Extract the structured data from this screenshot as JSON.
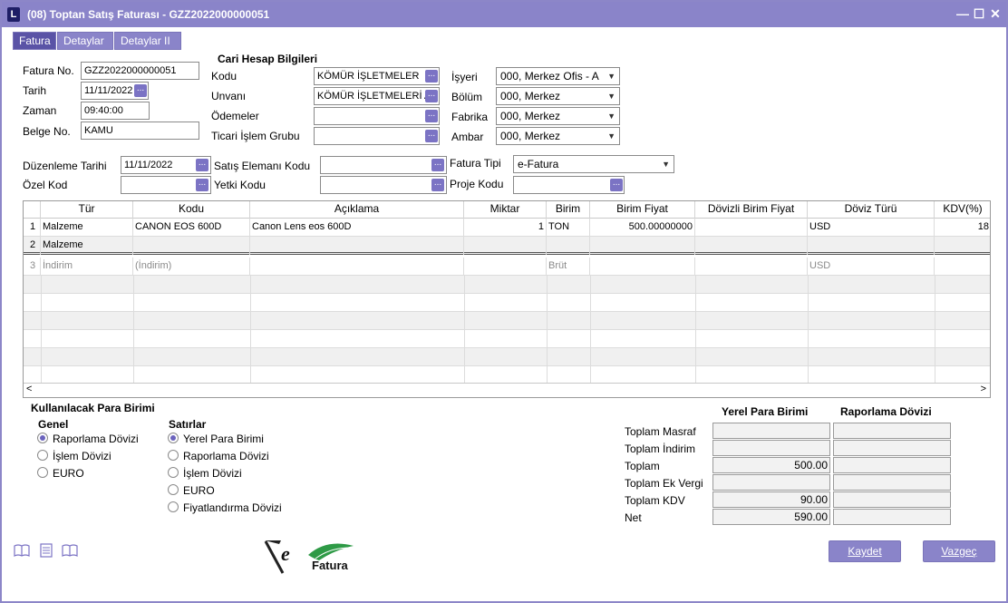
{
  "window": {
    "title": "(08) Toptan Satış Faturası - GZZ2022000000051",
    "app_letter": "L"
  },
  "tabs": [
    "Fatura",
    "Detaylar",
    "Detaylar II"
  ],
  "left": {
    "fatura_no_label": "Fatura No.",
    "fatura_no": "GZZ2022000000051",
    "tarih_label": "Tarih",
    "tarih": "11/11/2022",
    "zaman_label": "Zaman",
    "zaman": "09:40:00",
    "belge_no_label": "Belge No.",
    "belge_no": "KAMU"
  },
  "cari": {
    "heading": "Cari Hesap Bilgileri",
    "kodu_label": "Kodu",
    "kodu": "KÖMÜR İŞLETMELER",
    "unvani_label": "Unvanı",
    "unvani": "KÖMÜR İŞLETMELERİ AN",
    "odemeler_label": "Ödemeler",
    "odemeler": "",
    "ticari_label": "Ticari İşlem Grubu",
    "ticari": ""
  },
  "org": {
    "isyeri_label": "İşyeri",
    "isyeri": "000, Merkez Ofis - A",
    "bolum_label": "Bölüm",
    "bolum": "000, Merkez",
    "fabrika_label": "Fabrika",
    "fabrika": "000, Merkez",
    "ambar_label": "Ambar",
    "ambar": "000, Merkez"
  },
  "mid": {
    "duzenleme_label": "Düzenleme Tarihi",
    "duzenleme": "11/11/2022",
    "ozel_kod_label": "Özel Kod",
    "ozel_kod": "",
    "satis_label": "Satış Elemanı Kodu",
    "satis": "",
    "yetki_label": "Yetki Kodu",
    "yetki": "",
    "fatura_tipi_label": "Fatura Tipi",
    "fatura_tipi": "e-Fatura",
    "proje_label": "Proje Kodu",
    "proje": ""
  },
  "grid": {
    "columns": [
      "Tür",
      "Kodu",
      "Açıklama",
      "Miktar",
      "Birim",
      "Birim Fiyat",
      "Dövizli Birim Fiyat",
      "Döviz Türü",
      "KDV(%)"
    ],
    "rows": [
      {
        "n": "1",
        "tur": "Malzeme",
        "kodu": "CANON EOS 600D",
        "aciklama": "Canon Lens eos 600D",
        "miktar": "1",
        "birim": "TON",
        "fiyat": "500.00000000",
        "dfiyat": "",
        "doviz": "USD",
        "kdv": "18"
      },
      {
        "n": "2",
        "tur": "Malzeme",
        "kodu": "",
        "aciklama": "",
        "miktar": "",
        "birim": "",
        "fiyat": "",
        "dfiyat": "",
        "doviz": "",
        "kdv": ""
      },
      {
        "n": "3",
        "tur": "İndirim",
        "kodu": "(İndirim)",
        "aciklama": "",
        "miktar": "",
        "birim": "Brüt",
        "fiyat": "",
        "dfiyat": "",
        "doviz": "USD",
        "kdv": ""
      }
    ],
    "scroll_left": "<",
    "scroll_right": ">"
  },
  "currency": {
    "heading": "Kullanılacak Para Birimi",
    "genel_label": "Genel",
    "genel": [
      {
        "label": "Raporlama Dövizi",
        "on": true
      },
      {
        "label": "İşlem Dövizi",
        "on": false
      },
      {
        "label": "EURO",
        "on": false
      }
    ],
    "satirlar_label": "Satırlar",
    "satirlar": [
      {
        "label": "Yerel Para Birimi",
        "on": true
      },
      {
        "label": "Raporlama Dövizi",
        "on": false
      },
      {
        "label": "İşlem Dövizi",
        "on": false
      },
      {
        "label": "EURO",
        "on": false
      },
      {
        "label": "Fiyatlandırma Dövizi",
        "on": false
      }
    ]
  },
  "totals": {
    "col1": "Yerel Para Birimi",
    "col2": "Raporlama Dövizi",
    "rows": [
      {
        "label": "Toplam Masraf",
        "v1": "",
        "v2": ""
      },
      {
        "label": "Toplam İndirim",
        "v1": "",
        "v2": ""
      },
      {
        "label": "Toplam",
        "v1": "500.00",
        "v2": ""
      },
      {
        "label": "Toplam Ek Vergi",
        "v1": "",
        "v2": ""
      },
      {
        "label": "Toplam KDV",
        "v1": "90.00",
        "v2": ""
      },
      {
        "label": "Net",
        "v1": "590.00",
        "v2": ""
      }
    ]
  },
  "logo": {
    "letter": "e",
    "text": "Fatura"
  },
  "buttons": {
    "save": "Kaydet",
    "cancel": "Vazgeç"
  },
  "colors": {
    "accent": "#8a84c9",
    "dots": "#7b73c4"
  }
}
